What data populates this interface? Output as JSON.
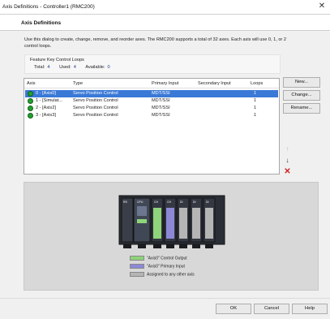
{
  "window": {
    "title": "Axis Definitions - Controller1 (RMC200)"
  },
  "header": {
    "title": "Axis Definitions"
  },
  "description": "Use this dialog to create, change, remove, and reorder axes. The RMC200 supports a total of 32 axes. Each axis will use 0, 1, or 2 control loops.",
  "feature_key": {
    "label": "Feature Key Control Loops",
    "total_label": "Total:",
    "total_value": "4",
    "used_label": "Used:",
    "used_value": "4",
    "available_label": "Available:",
    "available_value": "0"
  },
  "table": {
    "columns": [
      "Axis",
      "Type",
      "Primary Input",
      "Secondary Input",
      "Loops"
    ],
    "rows": [
      {
        "axis": "0 - [Axis0]",
        "type": "Servo Position Control",
        "primary": "MDT/SSI",
        "secondary": "",
        "loops": "1",
        "selected": true
      },
      {
        "axis": "1 - [Simulat...",
        "type": "Servo Position Control",
        "primary": "MDT/SSI",
        "secondary": "",
        "loops": "1",
        "selected": false
      },
      {
        "axis": "2 - [Axis2]",
        "type": "Servo Position Control",
        "primary": "MDT/SSI",
        "secondary": "",
        "loops": "1",
        "selected": false
      },
      {
        "axis": "3 - [Axis3]",
        "type": "Servo Position Control",
        "primary": "MDT/SSI",
        "secondary": "",
        "loops": "1",
        "selected": false
      }
    ]
  },
  "side_buttons": {
    "new": "New...",
    "change": "Change...",
    "rename": "Rename..."
  },
  "diagram": {
    "module_labels": [
      "RS",
      "CPU",
      "CH",
      "CH",
      "DI",
      "DI",
      "DI"
    ],
    "legend": [
      {
        "label": "\"Axis0\" Control Output",
        "color": "#8fd47a"
      },
      {
        "label": "\"Axis0\" Primary Input",
        "color": "#8d88d6"
      },
      {
        "label": "Assigned to any other axis",
        "color": "#b5b5b5"
      }
    ]
  },
  "footer": {
    "ok": "OK",
    "cancel": "Cancel",
    "help": "Help"
  },
  "colors": {
    "selection": "#3a79d6",
    "status_ok": "#23a030",
    "delete": "#d62020"
  }
}
